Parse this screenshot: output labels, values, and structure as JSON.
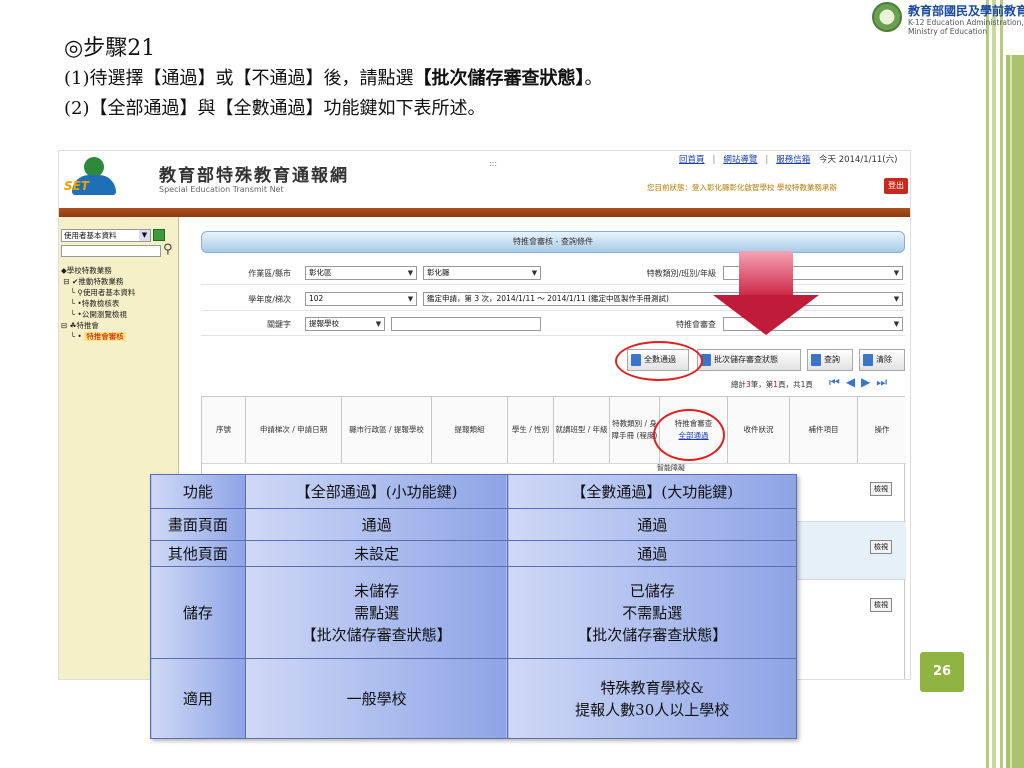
{
  "slide": {
    "step_title": "◎步驟21",
    "instruction_1_prefix": "(1)待選擇【通過】或【不通過】後，請點選",
    "instruction_1_bold": "【批次儲存審查狀態】",
    "instruction_1_suffix": "。",
    "instruction_2": "(2)【全部通過】與【全數通過】功能鍵如下表所述。",
    "page_number": "26"
  },
  "ministry": {
    "name_zh": "教育部國民及學前教育署",
    "name_en_1": "K-12 Education Administration,",
    "name_en_2": "Ministry of Education"
  },
  "site": {
    "logo_text": "SET",
    "title": "教育部特殊教育通報網",
    "subtitle": "Special Education Transmit Net",
    "dots": ":::",
    "top_links": [
      "回首頁",
      "網站導覽",
      "服務信箱"
    ],
    "date": "今天 2014/1/11(六)",
    "user_status": "您目前狀態：登入彰化縣彰化啟智學校 學校特教業務承辦",
    "logout": "登出"
  },
  "sidebar": {
    "select_value": "使用者基本資料",
    "tree": [
      "學校特教業務",
      "推動特教業務",
      "使用者基本資料",
      "特教檢核表",
      "公開瀏覽檢視",
      "特推會",
      "特推會審核"
    ]
  },
  "main": {
    "panel_title": "特推會審核 - 查詢條件",
    "row1": {
      "label": "作業區/縣市",
      "region": "彰化區",
      "county": "彰化縣",
      "label2": "特教類別/班別/年級"
    },
    "row2": {
      "label": "學年度/梯次",
      "year": "102",
      "batch": "鑑定申請，第 3 次，2014/1/11 ～ 2014/1/11 (鑑定中區製作手冊測試)"
    },
    "row3": {
      "label": "關鍵字",
      "keyword_type": "提報學校",
      "label2": "特推會審查"
    },
    "buttons": {
      "all_pass": "全數通過",
      "batch_save": "批次儲存審查狀態",
      "query": "查詢",
      "clear": "清除"
    },
    "pager": {
      "prefix": "總計",
      "total": "3",
      "mid1": "筆，第",
      "page": "1",
      "mid2": "頁，共",
      "pages": "1",
      "suffix": "頁"
    },
    "grid_headers": [
      "序號",
      "申請梯次 / 申請日期",
      "縣市行政區 / 提報學校",
      "提報類組",
      "學生 / 性別",
      "就讀班型 / 年級",
      "特教類別 / 身障手冊 (程度)",
      "特推會審查",
      "收件狀況",
      "補件項目",
      "操作"
    ],
    "grid_header_link": "全部通過",
    "overflow_label": "智能障礙",
    "view_label": "檢視"
  },
  "compare_table": {
    "header": [
      "功能",
      "【全部通過】(小功能鍵)",
      "【全數通過】(大功能鍵)"
    ],
    "rows": [
      {
        "label": "畫面頁面",
        "small": [
          "通過"
        ],
        "big": [
          "通過"
        ]
      },
      {
        "label": "其他頁面",
        "small": [
          "未設定"
        ],
        "big": [
          "通過"
        ]
      },
      {
        "label": "儲存",
        "small": [
          "未儲存",
          "需點選",
          "【批次儲存審查狀態】"
        ],
        "big": [
          "已儲存",
          "不需點選",
          "【批次儲存審查狀態】"
        ]
      },
      {
        "label": "適用",
        "small": [
          "一般學校"
        ],
        "big": [
          "特殊教育學校&",
          "提報人數30人以上學校"
        ]
      }
    ]
  }
}
